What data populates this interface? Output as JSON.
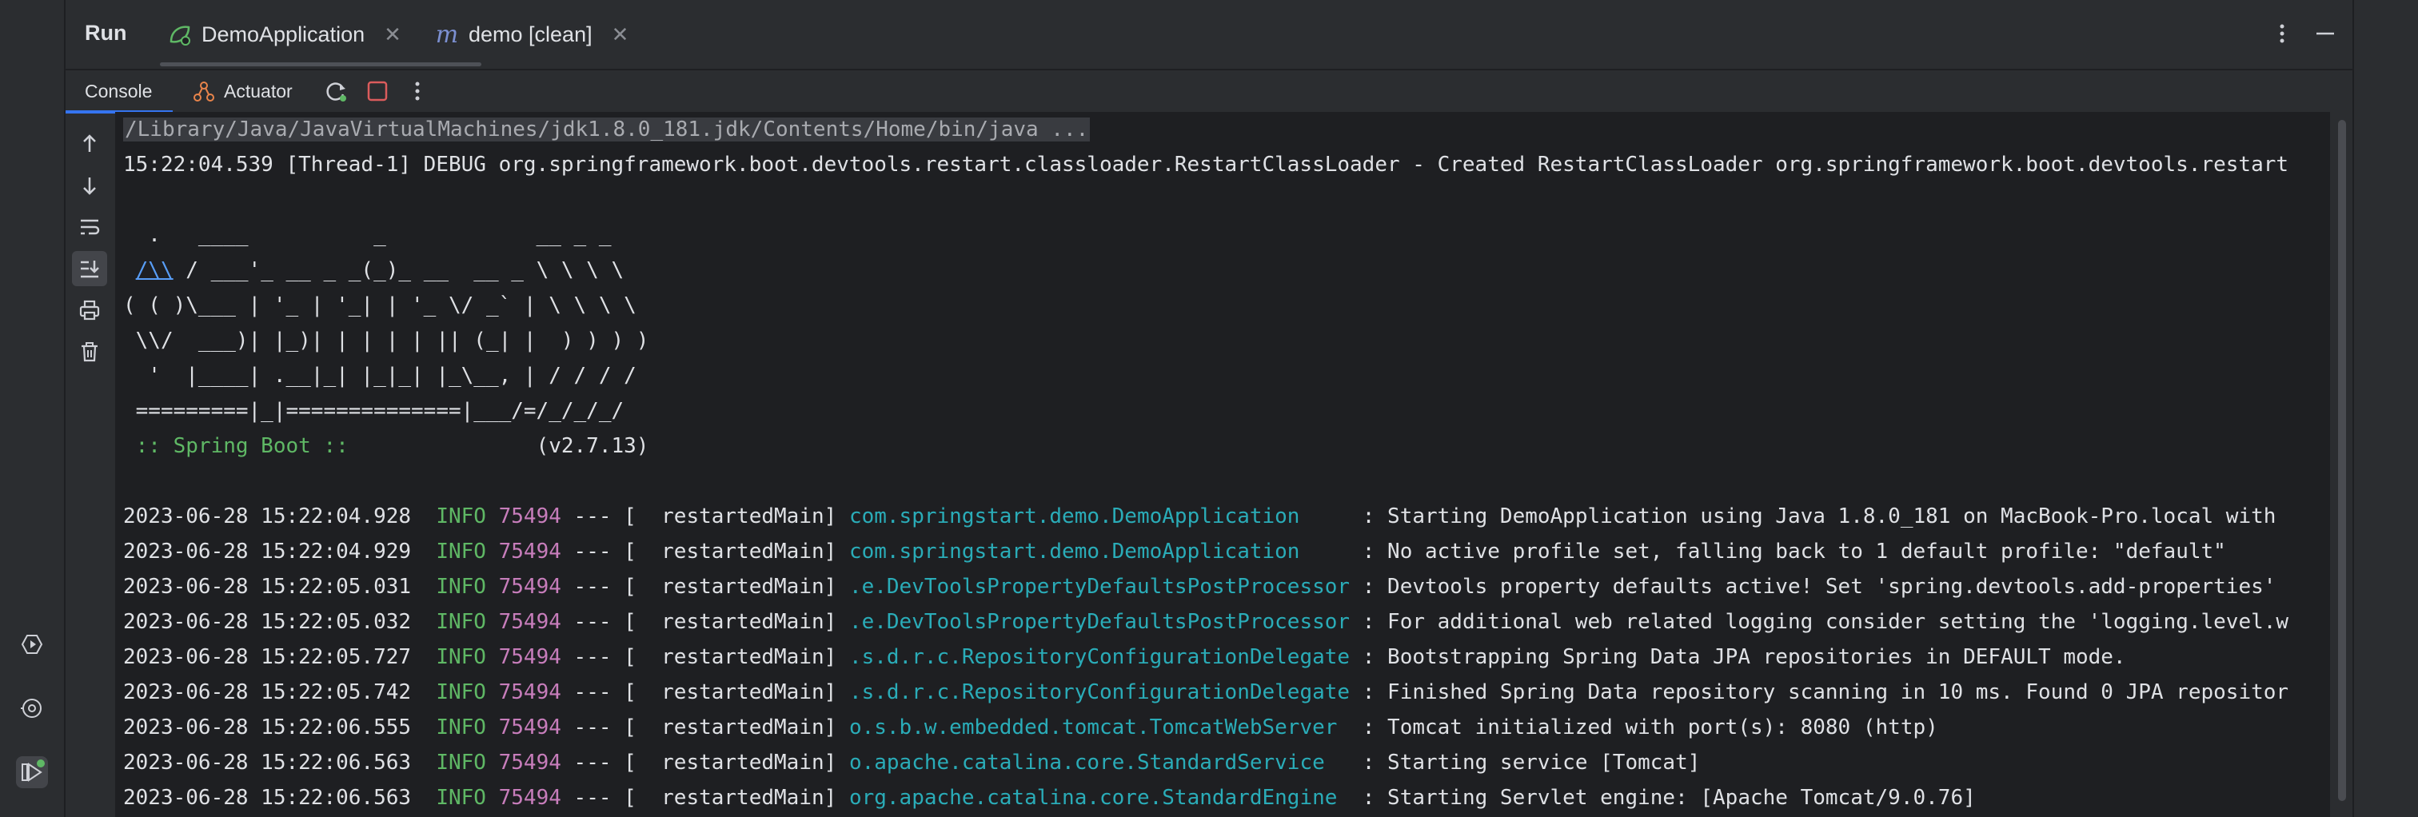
{
  "header": {
    "title": "Run",
    "tabs": [
      {
        "label": "DemoApplication",
        "icon": "spring-run-icon"
      },
      {
        "label": "demo [clean]",
        "icon": "maven-icon"
      }
    ]
  },
  "console_toolbar": {
    "tabs": [
      {
        "label": "Console"
      },
      {
        "label": "Actuator",
        "icon": "actuator-icon"
      }
    ]
  },
  "console": {
    "command": "/Library/Java/JavaVirtualMachines/jdk1.8.0_181.jdk/Contents/Home/bin/java ...",
    "debug_line": "15:22:04.539 [Thread-1] DEBUG org.springframework.boot.devtools.restart.classloader.RestartClassLoader - Created RestartClassLoader org.springframework.boot.devtools.restart",
    "banner": {
      "l1": "  .   ____          _            __ _ _",
      "l2_pre": " ",
      "l2_link": "/\\\\",
      "l2_post": " / ___'_ __ _ _(_)_ __  __ _ \\ \\ \\ \\",
      "l3": "( ( )\\___ | '_ | '_| | '_ \\/ _` | \\ \\ \\ \\",
      "l4": " \\\\/  ___)| |_)| | | | | || (_| |  ) ) ) )",
      "l5": "  '  |____| .__|_| |_|_| |_\\__, | / / / /",
      "l6": " =========|_|==============|___/=/_/_/_/",
      "l7_label": " :: Spring Boot ::",
      "l7_version": "               (v2.7.13)"
    },
    "logs": [
      {
        "ts": "2023-06-28 15:22:04.928",
        "level": "INFO",
        "pid": "75494",
        "sep": " --- [  restartedMain] ",
        "logger": "com.springstart.demo.DemoApplication    ",
        "msg": " : Starting DemoApplication using Java 1.8.0_181 on MacBook-Pro.local with"
      },
      {
        "ts": "2023-06-28 15:22:04.929",
        "level": "INFO",
        "pid": "75494",
        "sep": " --- [  restartedMain] ",
        "logger": "com.springstart.demo.DemoApplication    ",
        "msg": " : No active profile set, falling back to 1 default profile: \"default\""
      },
      {
        "ts": "2023-06-28 15:22:05.031",
        "level": "INFO",
        "pid": "75494",
        "sep": " --- [  restartedMain] ",
        "logger": ".e.DevToolsPropertyDefaultsPostProcessor",
        "msg": " : Devtools property defaults active! Set 'spring.devtools.add-properties'"
      },
      {
        "ts": "2023-06-28 15:22:05.032",
        "level": "INFO",
        "pid": "75494",
        "sep": " --- [  restartedMain] ",
        "logger": ".e.DevToolsPropertyDefaultsPostProcessor",
        "msg": " : For additional web related logging consider setting the 'logging.level.w"
      },
      {
        "ts": "2023-06-28 15:22:05.727",
        "level": "INFO",
        "pid": "75494",
        "sep": " --- [  restartedMain] ",
        "logger": ".s.d.r.c.RepositoryConfigurationDelegate",
        "msg": " : Bootstrapping Spring Data JPA repositories in DEFAULT mode."
      },
      {
        "ts": "2023-06-28 15:22:05.742",
        "level": "INFO",
        "pid": "75494",
        "sep": " --- [  restartedMain] ",
        "logger": ".s.d.r.c.RepositoryConfigurationDelegate",
        "msg": " : Finished Spring Data repository scanning in 10 ms. Found 0 JPA repositor"
      },
      {
        "ts": "2023-06-28 15:22:06.555",
        "level": "INFO",
        "pid": "75494",
        "sep": " --- [  restartedMain] ",
        "logger": "o.s.b.w.embedded.tomcat.TomcatWebServer ",
        "msg": " : Tomcat initialized with port(s): 8080 (http)"
      },
      {
        "ts": "2023-06-28 15:22:06.563",
        "level": "INFO",
        "pid": "75494",
        "sep": " --- [  restartedMain] ",
        "logger": "o.apache.catalina.core.StandardService  ",
        "msg": " : Starting service [Tomcat]"
      },
      {
        "ts": "2023-06-28 15:22:06.563",
        "level": "INFO",
        "pid": "75494",
        "sep": " --- [  restartedMain] ",
        "logger": "org.apache.catalina.core.StandardEngine ",
        "msg": " : Starting Servlet engine: [Apache Tomcat/9.0.76]"
      }
    ]
  },
  "colors": {
    "accent": "#3574f0",
    "info_level": "#5fb865",
    "pid": "#c77dbb",
    "logger": "#2aacb8",
    "stop": "#db5c5c"
  }
}
